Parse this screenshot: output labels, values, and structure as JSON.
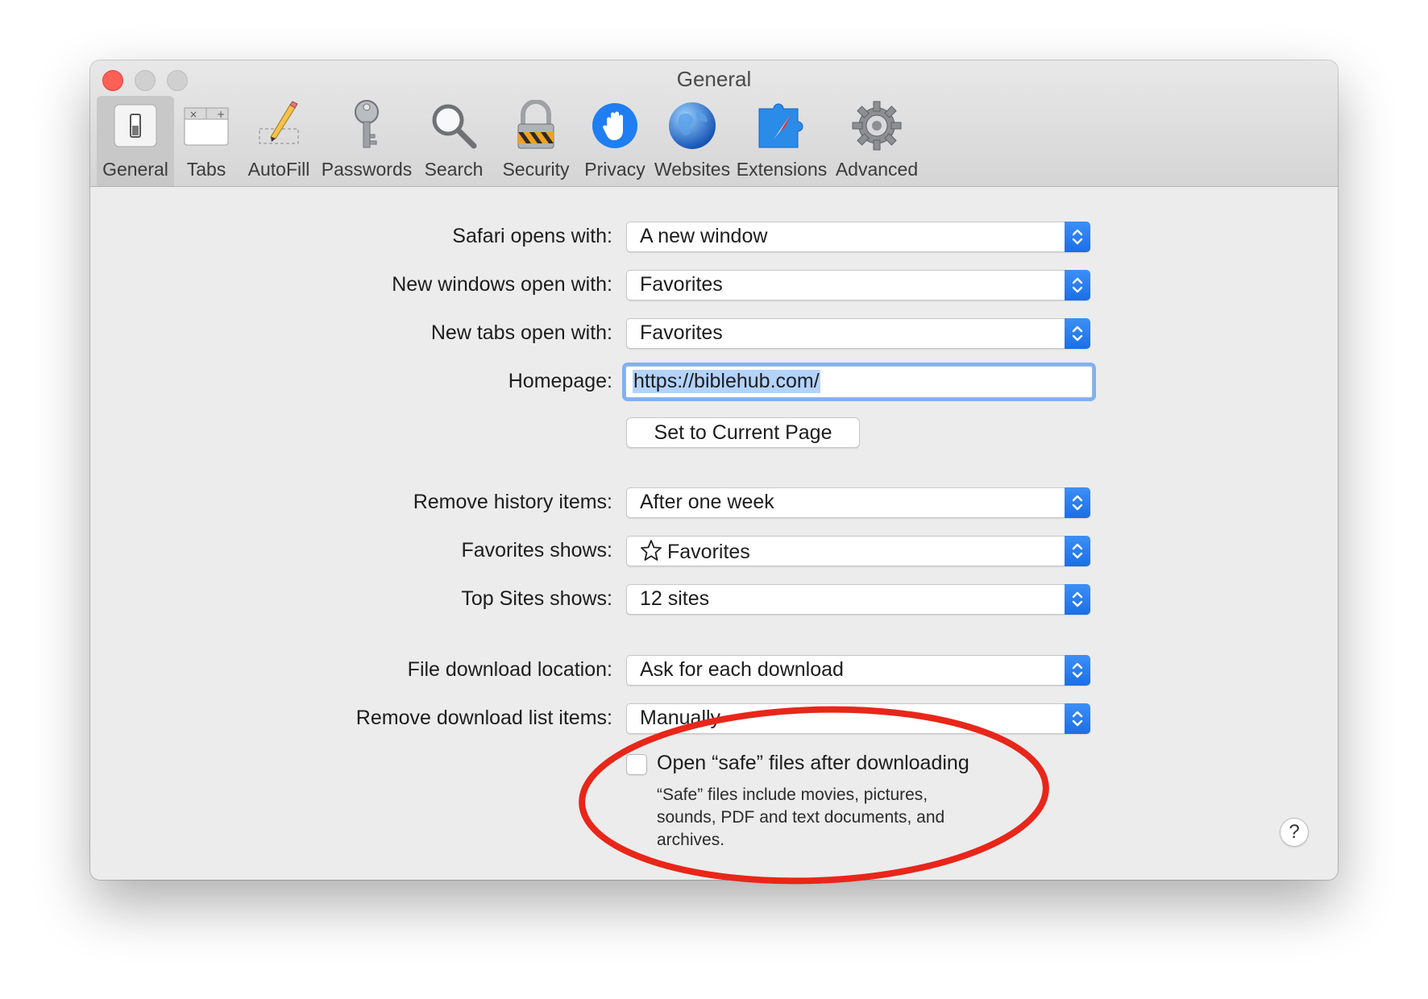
{
  "window": {
    "title": "General"
  },
  "toolbar": {
    "items": [
      {
        "label": "General",
        "icon": "general-switch-icon",
        "active": true
      },
      {
        "label": "Tabs",
        "icon": "tabs-icon"
      },
      {
        "label": "AutoFill",
        "icon": "pencil-icon"
      },
      {
        "label": "Passwords",
        "icon": "key-icon"
      },
      {
        "label": "Search",
        "icon": "magnifier-icon"
      },
      {
        "label": "Security",
        "icon": "padlock-icon"
      },
      {
        "label": "Privacy",
        "icon": "hand-icon"
      },
      {
        "label": "Websites",
        "icon": "globe-icon"
      },
      {
        "label": "Extensions",
        "icon": "puzzle-compass-icon"
      },
      {
        "label": "Advanced",
        "icon": "gear-icon"
      }
    ]
  },
  "settings": {
    "safari_opens_with": {
      "label": "Safari opens with:",
      "value": "A new window"
    },
    "new_windows_open_with": {
      "label": "New windows open with:",
      "value": "Favorites"
    },
    "new_tabs_open_with": {
      "label": "New tabs open with:",
      "value": "Favorites"
    },
    "homepage": {
      "label": "Homepage:",
      "value": "https://biblehub.com/"
    },
    "set_current_page": "Set to Current Page",
    "remove_history_items": {
      "label": "Remove history items:",
      "value": "After one week"
    },
    "favorites_shows": {
      "label": "Favorites shows:",
      "value": "Favorites",
      "icon": "star-icon"
    },
    "top_sites_shows": {
      "label": "Top Sites shows:",
      "value": "12 sites"
    },
    "file_download_location": {
      "label": "File download location:",
      "value": "Ask for each download"
    },
    "remove_download_list_items": {
      "label": "Remove download list items:",
      "value": "Manually"
    },
    "open_safe_files": {
      "label": "Open “safe” files after downloading",
      "checked": false,
      "description": "“Safe” files include movies, pictures, sounds, PDF and text documents, and archives."
    },
    "help": "?"
  },
  "colors": {
    "accent_blue": "#1a6fe6",
    "annotation_red": "#e8261a",
    "close_red": "#fe5f57"
  }
}
